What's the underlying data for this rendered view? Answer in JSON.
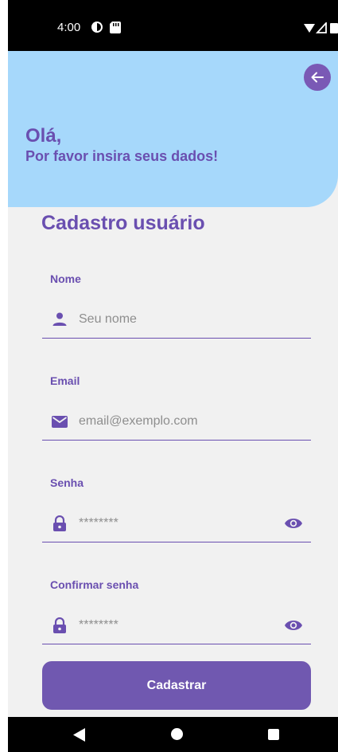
{
  "status_bar": {
    "time": "4:00"
  },
  "header": {
    "greeting": "Olá,",
    "subtitle": "Por favor insira seus dados!",
    "back_icon": "arrow-left-icon"
  },
  "form": {
    "title": "Cadastro usuário",
    "fields": [
      {
        "label": "Nome",
        "placeholder": "Seu nome",
        "icon": "person-icon"
      },
      {
        "label": "Email",
        "placeholder": "email@exemplo.com",
        "icon": "envelope-icon"
      },
      {
        "label": "Senha",
        "placeholder": "********",
        "icon": "lock-icon",
        "toggle_icon": "eye-icon"
      },
      {
        "label": "Confirmar senha",
        "placeholder": "********",
        "icon": "lock-icon",
        "toggle_icon": "eye-icon"
      }
    ],
    "submit_label": "Cadastrar"
  },
  "colors": {
    "primary": "#6a4fb0",
    "button": "#7058b0",
    "header_bg": "#a6d8fb",
    "page_bg": "#f1f1f1"
  }
}
